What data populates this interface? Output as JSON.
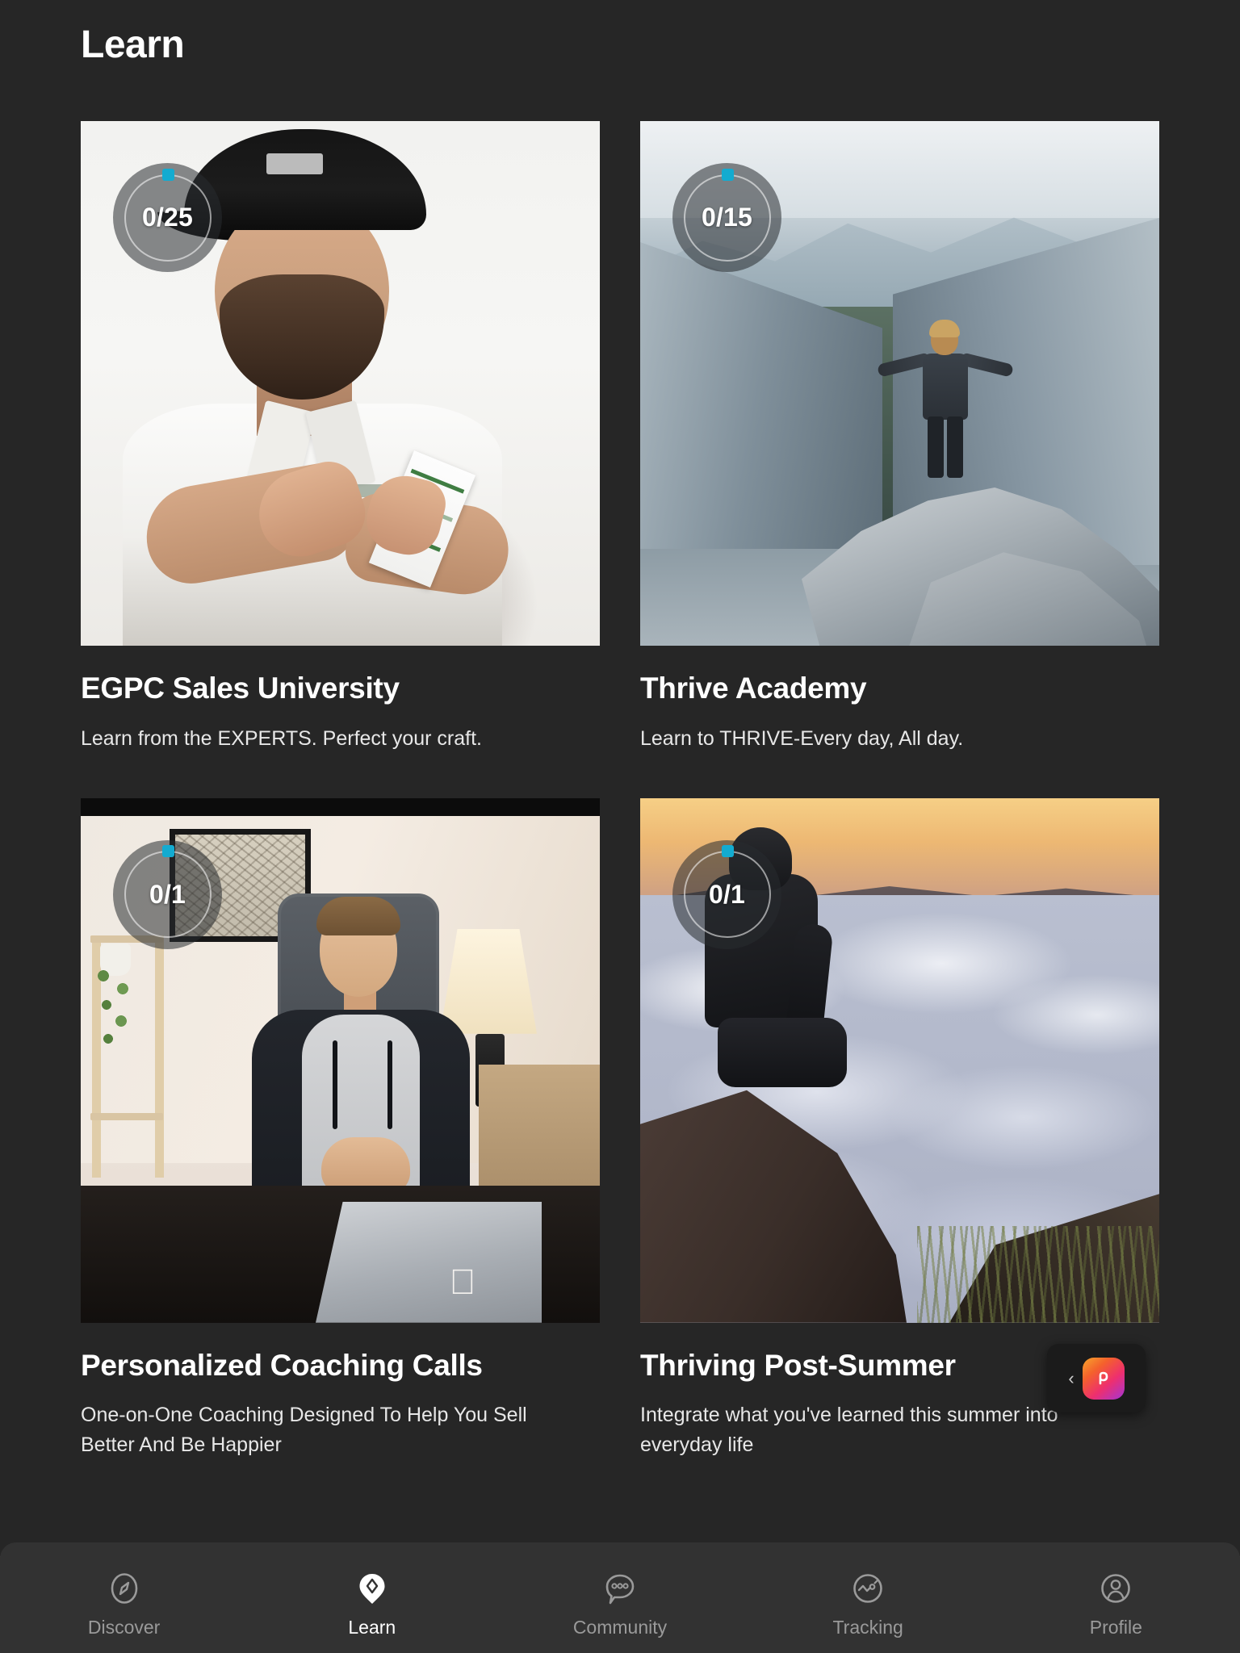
{
  "header": {
    "title": "Learn"
  },
  "cards": [
    {
      "badge": "0/25",
      "title": "EGPC Sales University",
      "subtitle": "Learn from the EXPERTS. Perfect your craft.",
      "image_alt": "bearded man in white polo holding a card"
    },
    {
      "badge": "0/15",
      "title": "Thrive Academy",
      "subtitle": "Learn to THRIVE-Every day, All day.",
      "image_alt": "man standing on cliff with arms outstretched over valley"
    },
    {
      "badge": "0/1",
      "title": "Personalized Coaching Calls",
      "subtitle": "One-on-One Coaching Designed To Help You Sell Better And Be Happier",
      "image_alt": "young man at desk with laptop in home office"
    },
    {
      "badge": "0/1",
      "title": "Thriving Post-Summer",
      "subtitle": "Integrate what you've learned this summer into everyday life",
      "image_alt": "person sitting on rock above a sea of clouds at sunrise"
    }
  ],
  "chat_widget": {
    "collapse_label": "‹",
    "icon": "chat-launcher-icon"
  },
  "tabbar": [
    {
      "label": "Discover",
      "icon": "compass-icon",
      "active": false
    },
    {
      "label": "Learn",
      "icon": "diamond-pin-icon",
      "active": true
    },
    {
      "label": "Community",
      "icon": "chat-bubble-icon",
      "active": false
    },
    {
      "label": "Tracking",
      "icon": "chart-circle-icon",
      "active": false
    },
    {
      "label": "Profile",
      "icon": "person-circle-icon",
      "active": false
    }
  ],
  "colors": {
    "background": "#262626",
    "tabbar": "#323232",
    "accent": "#13abd0",
    "text_primary": "#ffffff",
    "text_muted": "#9a9a9a"
  }
}
